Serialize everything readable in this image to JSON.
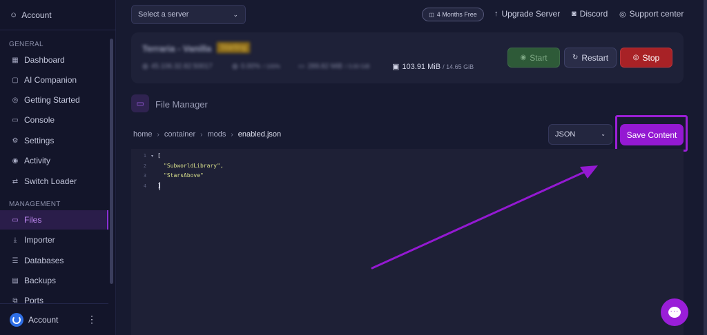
{
  "sidebar": {
    "top_account": "Account",
    "section_general": "GENERAL",
    "section_management": "MANAGEMENT",
    "general_items": [
      {
        "label": "Dashboard",
        "icon": "grid-icon"
      },
      {
        "label": "AI Companion",
        "icon": "chat-bot-icon"
      },
      {
        "label": "Getting Started",
        "icon": "help-circle-icon"
      },
      {
        "label": "Console",
        "icon": "terminal-icon"
      },
      {
        "label": "Settings",
        "icon": "gear-icon"
      },
      {
        "label": "Activity",
        "icon": "eye-icon"
      },
      {
        "label": "Switch Loader",
        "icon": "swap-icon"
      }
    ],
    "management_items": [
      {
        "label": "Files",
        "icon": "folder-icon",
        "active": true
      },
      {
        "label": "Importer",
        "icon": "download-icon"
      },
      {
        "label": "Databases",
        "icon": "database-icon"
      },
      {
        "label": "Backups",
        "icon": "archive-icon"
      },
      {
        "label": "Ports",
        "icon": "network-icon"
      }
    ],
    "bottom_account": "Account"
  },
  "topbar": {
    "server_select_placeholder": "Select a server",
    "promo_pill": "4 Months Free",
    "upgrade": "Upgrade Server",
    "discord": "Discord",
    "support": "Support center"
  },
  "server": {
    "name": "Terraria - Vanilla",
    "status": "Starting",
    "ip": "45.106.32.82:50017",
    "cpu": "0.00%",
    "cpu_limit": "/ 100%",
    "memory": "289.82 MiB",
    "memory_limit": "/ 3.00 GiB",
    "disk": "103.91 MiB",
    "disk_limit": "/ 14.65 GiB",
    "start_label": "Start",
    "restart_label": "Restart",
    "stop_label": "Stop"
  },
  "file_manager": {
    "title": "File Manager",
    "breadcrumb": [
      "home",
      "container",
      "mods",
      "enabled.json"
    ],
    "language": "JSON",
    "save_label": "Save Content",
    "code_lines": [
      {
        "n": "1",
        "text": "["
      },
      {
        "n": "2",
        "text": "\"SubworldLibrary\","
      },
      {
        "n": "3",
        "text": "\"StarsAbove\""
      },
      {
        "n": "4",
        "text": "]"
      }
    ]
  },
  "colors": {
    "accent": "#9419d2",
    "stop": "#a82226",
    "start": "#2e5a38"
  }
}
